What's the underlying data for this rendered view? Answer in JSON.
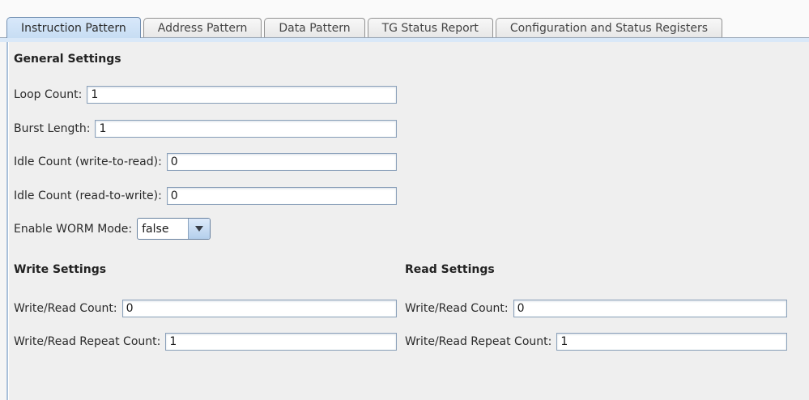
{
  "tabs": [
    {
      "label": "Instruction Pattern",
      "active": true
    },
    {
      "label": "Address Pattern",
      "active": false
    },
    {
      "label": "Data Pattern",
      "active": false
    },
    {
      "label": "TG Status Report",
      "active": false
    },
    {
      "label": "Configuration and Status Registers",
      "active": false
    }
  ],
  "general": {
    "heading": "General Settings",
    "fields": [
      {
        "label": "Loop Count:",
        "value": "1"
      },
      {
        "label": "Burst Length:",
        "value": "1"
      },
      {
        "label": "Idle Count (write-to-read):",
        "value": "0"
      },
      {
        "label": "Idle Count (read-to-write):",
        "value": "0"
      }
    ],
    "worm": {
      "label": "Enable WORM Mode:",
      "value": "false"
    }
  },
  "write_settings": {
    "heading": "Write Settings",
    "fields": [
      {
        "label": "Write/Read Count:",
        "value": "0"
      },
      {
        "label": "Write/Read Repeat Count:",
        "value": "1"
      }
    ]
  },
  "read_settings": {
    "heading": "Read Settings",
    "fields": [
      {
        "label": "Write/Read Count:",
        "value": "0"
      },
      {
        "label": "Write/Read Repeat Count:",
        "value": "1"
      }
    ]
  },
  "icons": {
    "combo_arrow": "dropdown-arrow-icon"
  },
  "colors": {
    "active_tab": "#cde1f5",
    "tab_band": "#d9e8f8",
    "panel_background": "#efefef",
    "field_border": "#8ba1ba",
    "panel_left_border": "#a9c0da"
  }
}
